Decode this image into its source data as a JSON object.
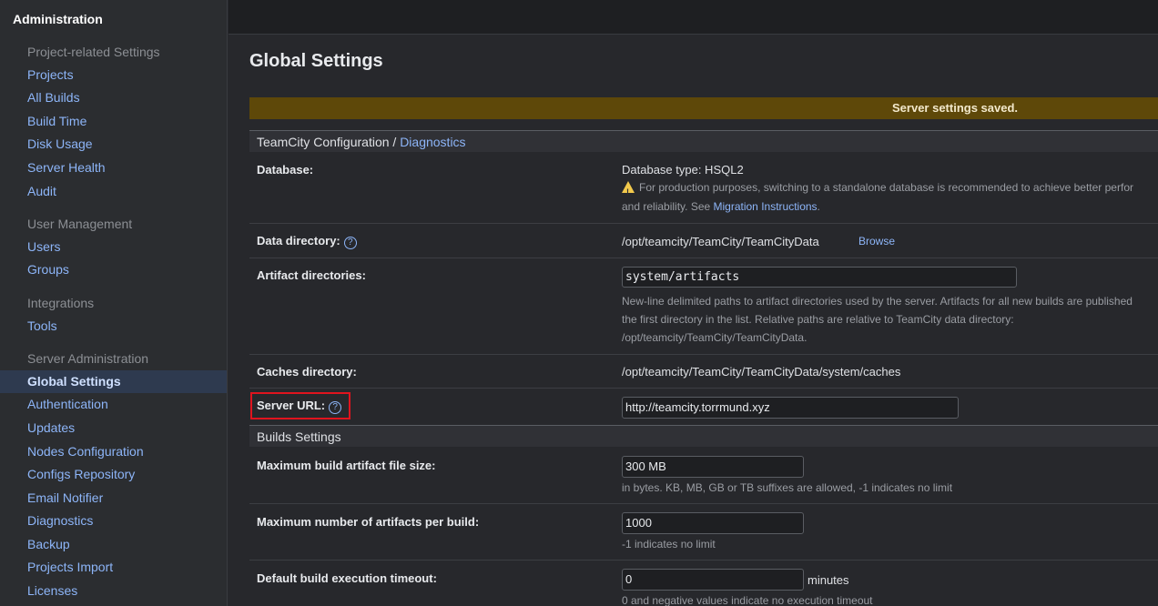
{
  "sidebar": {
    "title": "Administration",
    "sections": {
      "project": "Project-related Settings",
      "user": "User Management",
      "integrations": "Integrations",
      "server": "Server Administration"
    },
    "items": {
      "projects": "Projects",
      "all_builds": "All Builds",
      "build_time": "Build Time",
      "disk_usage": "Disk Usage",
      "server_health": "Server Health",
      "audit": "Audit",
      "users": "Users",
      "groups": "Groups",
      "tools": "Tools",
      "global_settings": "Global Settings",
      "authentication": "Authentication",
      "updates": "Updates",
      "nodes_configuration": "Nodes Configuration",
      "configs_repository": "Configs Repository",
      "email_notifier": "Email Notifier",
      "diagnostics": "Diagnostics",
      "backup": "Backup",
      "projects_import": "Projects Import",
      "licenses": "Licenses"
    },
    "active": "Global Settings"
  },
  "main": {
    "title": "Global Settings",
    "banner": "Server settings saved.",
    "config_section": {
      "prefix": "TeamCity Configuration",
      "separator": " / ",
      "link": "Diagnostics"
    },
    "database": {
      "label": "Database:",
      "value": "Database type: HSQL2",
      "warning_line1": "For production purposes, switching to a standalone database is recommended to achieve better perfor",
      "warning_line2_prefix": "and reliability. See ",
      "warning_link": "Migration Instructions",
      "warning_line2_suffix": "."
    },
    "data_directory": {
      "label": "Data directory:",
      "value": "/opt/teamcity/TeamCity/TeamCityData",
      "browse": "Browse"
    },
    "artifact_directories": {
      "label": "Artifact directories:",
      "value": "system/artifacts",
      "note_line1": "New-line delimited paths to artifact directories used by the server. Artifacts for all new builds are published",
      "note_line2": "the first directory in the list. Relative paths are relative to TeamCity data directory:",
      "note_line3": "/opt/teamcity/TeamCity/TeamCityData."
    },
    "caches_directory": {
      "label": "Caches directory:",
      "value": "/opt/teamcity/TeamCity/TeamCityData/system/caches"
    },
    "server_url": {
      "label": "Server URL:",
      "value": "http://teamcity.torrmund.xyz"
    },
    "builds_section": "Builds Settings",
    "max_artifact_size": {
      "label": "Maximum build artifact file size:",
      "value": "300 MB",
      "note": "in bytes. KB, MB, GB or TB suffixes are allowed, -1 indicates no limit"
    },
    "max_artifacts": {
      "label": "Maximum number of artifacts per build:",
      "value": "1000",
      "note": "-1 indicates no limit"
    },
    "timeout": {
      "label": "Default build execution timeout:",
      "value": "0",
      "unit": "minutes",
      "note": "0 and negative values indicate no execution timeout"
    },
    "help_glyph": "?"
  },
  "colors": {
    "accent_link": "#8db5f8",
    "banner_bg": "#5e4809",
    "highlight": "#e0141e"
  }
}
